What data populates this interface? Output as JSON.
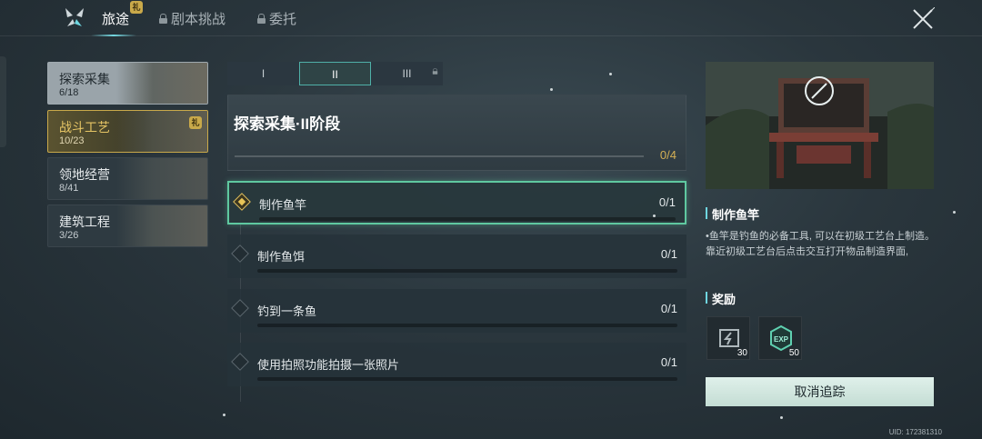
{
  "top_tabs": [
    {
      "label": "旅途",
      "active": true,
      "locked": false
    },
    {
      "label": "剧本挑战",
      "active": false,
      "locked": true
    },
    {
      "label": "委托",
      "active": false,
      "locked": true
    }
  ],
  "categories": [
    {
      "title": "探索采集",
      "count": "6/18",
      "state": "selected"
    },
    {
      "title": "战斗工艺",
      "count": "10/23",
      "state": "active-gold"
    },
    {
      "title": "领地经营",
      "count": "8/41",
      "state": "normal"
    },
    {
      "title": "建筑工程",
      "count": "3/26",
      "state": "normal"
    }
  ],
  "stage_tabs": [
    {
      "label": "I",
      "active": false,
      "locked": false
    },
    {
      "label": "II",
      "active": true,
      "locked": false
    },
    {
      "label": "III",
      "active": false,
      "locked": true
    }
  ],
  "stage": {
    "title": "探索采集·II阶段",
    "progress": "0/4"
  },
  "tasks": [
    {
      "label": "制作鱼竿",
      "value": "0/1",
      "highlighted": true
    },
    {
      "label": "制作鱼饵",
      "value": "0/1",
      "highlighted": false
    },
    {
      "label": "钓到一条鱼",
      "value": "0/1",
      "highlighted": false
    },
    {
      "label": "使用拍照功能拍摄一张照片",
      "value": "0/1",
      "highlighted": false
    }
  ],
  "detail": {
    "title": "制作鱼竿",
    "desc_line1": "•鱼竿是钓鱼的必备工具, 可以在初级工艺台上制造。",
    "desc_line2": "靠近初级工艺台后点击交互打开物品制造界面,"
  },
  "rewards": {
    "title": "奖励",
    "items": [
      {
        "icon": "energy-icon",
        "qty": "30"
      },
      {
        "icon": "exp-icon",
        "label": "EXP",
        "qty": "50"
      }
    ]
  },
  "cancel_label": "取消追踪",
  "uid": "UID: 172381310",
  "colors": {
    "accent_gold": "#e8c558",
    "accent_teal": "#5fc8a0",
    "button_bg": "#cfe5dd"
  }
}
